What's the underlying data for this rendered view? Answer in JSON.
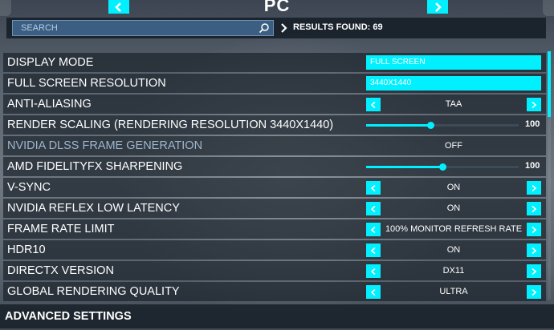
{
  "colors": {
    "accent": "#00f0ff",
    "row_bg": "#1c242d",
    "search_bg": "#3b5e82"
  },
  "header": {
    "title": "PC",
    "prev_icon": "chevron-left-icon",
    "next_icon": "chevron-right-icon"
  },
  "search": {
    "placeholder": "SEARCH",
    "value": "",
    "icon": "search-icon"
  },
  "results": {
    "label": "RESULTS FOUND: 69"
  },
  "settings": [
    {
      "label": "DISPLAY MODE",
      "type": "dropdown",
      "value": "FULL SCREEN"
    },
    {
      "label": "FULL SCREEN RESOLUTION",
      "type": "dropdown",
      "value": "3440X1440"
    },
    {
      "label": "ANTI-ALIASING",
      "type": "selector",
      "value": "TAA"
    },
    {
      "label": "RENDER SCALING (RENDERING RESOLUTION 3440X1440)",
      "type": "slider",
      "value": "100",
      "level": 0.42
    },
    {
      "label": "NVIDIA DLSS FRAME GENERATION",
      "type": "static",
      "value": "OFF",
      "disabled": true
    },
    {
      "label": "AMD FIDELITYFX SHARPENING",
      "type": "slider",
      "value": "100",
      "level": 0.5
    },
    {
      "label": "V-SYNC",
      "type": "selector",
      "value": "ON"
    },
    {
      "label": "NVIDIA REFLEX LOW LATENCY",
      "type": "selector",
      "value": "ON"
    },
    {
      "label": "FRAME RATE LIMIT",
      "type": "selector",
      "value": "100% MONITOR REFRESH RATE"
    },
    {
      "label": "HDR10",
      "type": "selector",
      "value": "ON"
    },
    {
      "label": "DIRECTX VERSION",
      "type": "selector",
      "value": "DX11"
    },
    {
      "label": "GLOBAL RENDERING QUALITY",
      "type": "selector",
      "value": "ULTRA"
    }
  ],
  "advanced": {
    "label": "ADVANCED SETTINGS"
  }
}
